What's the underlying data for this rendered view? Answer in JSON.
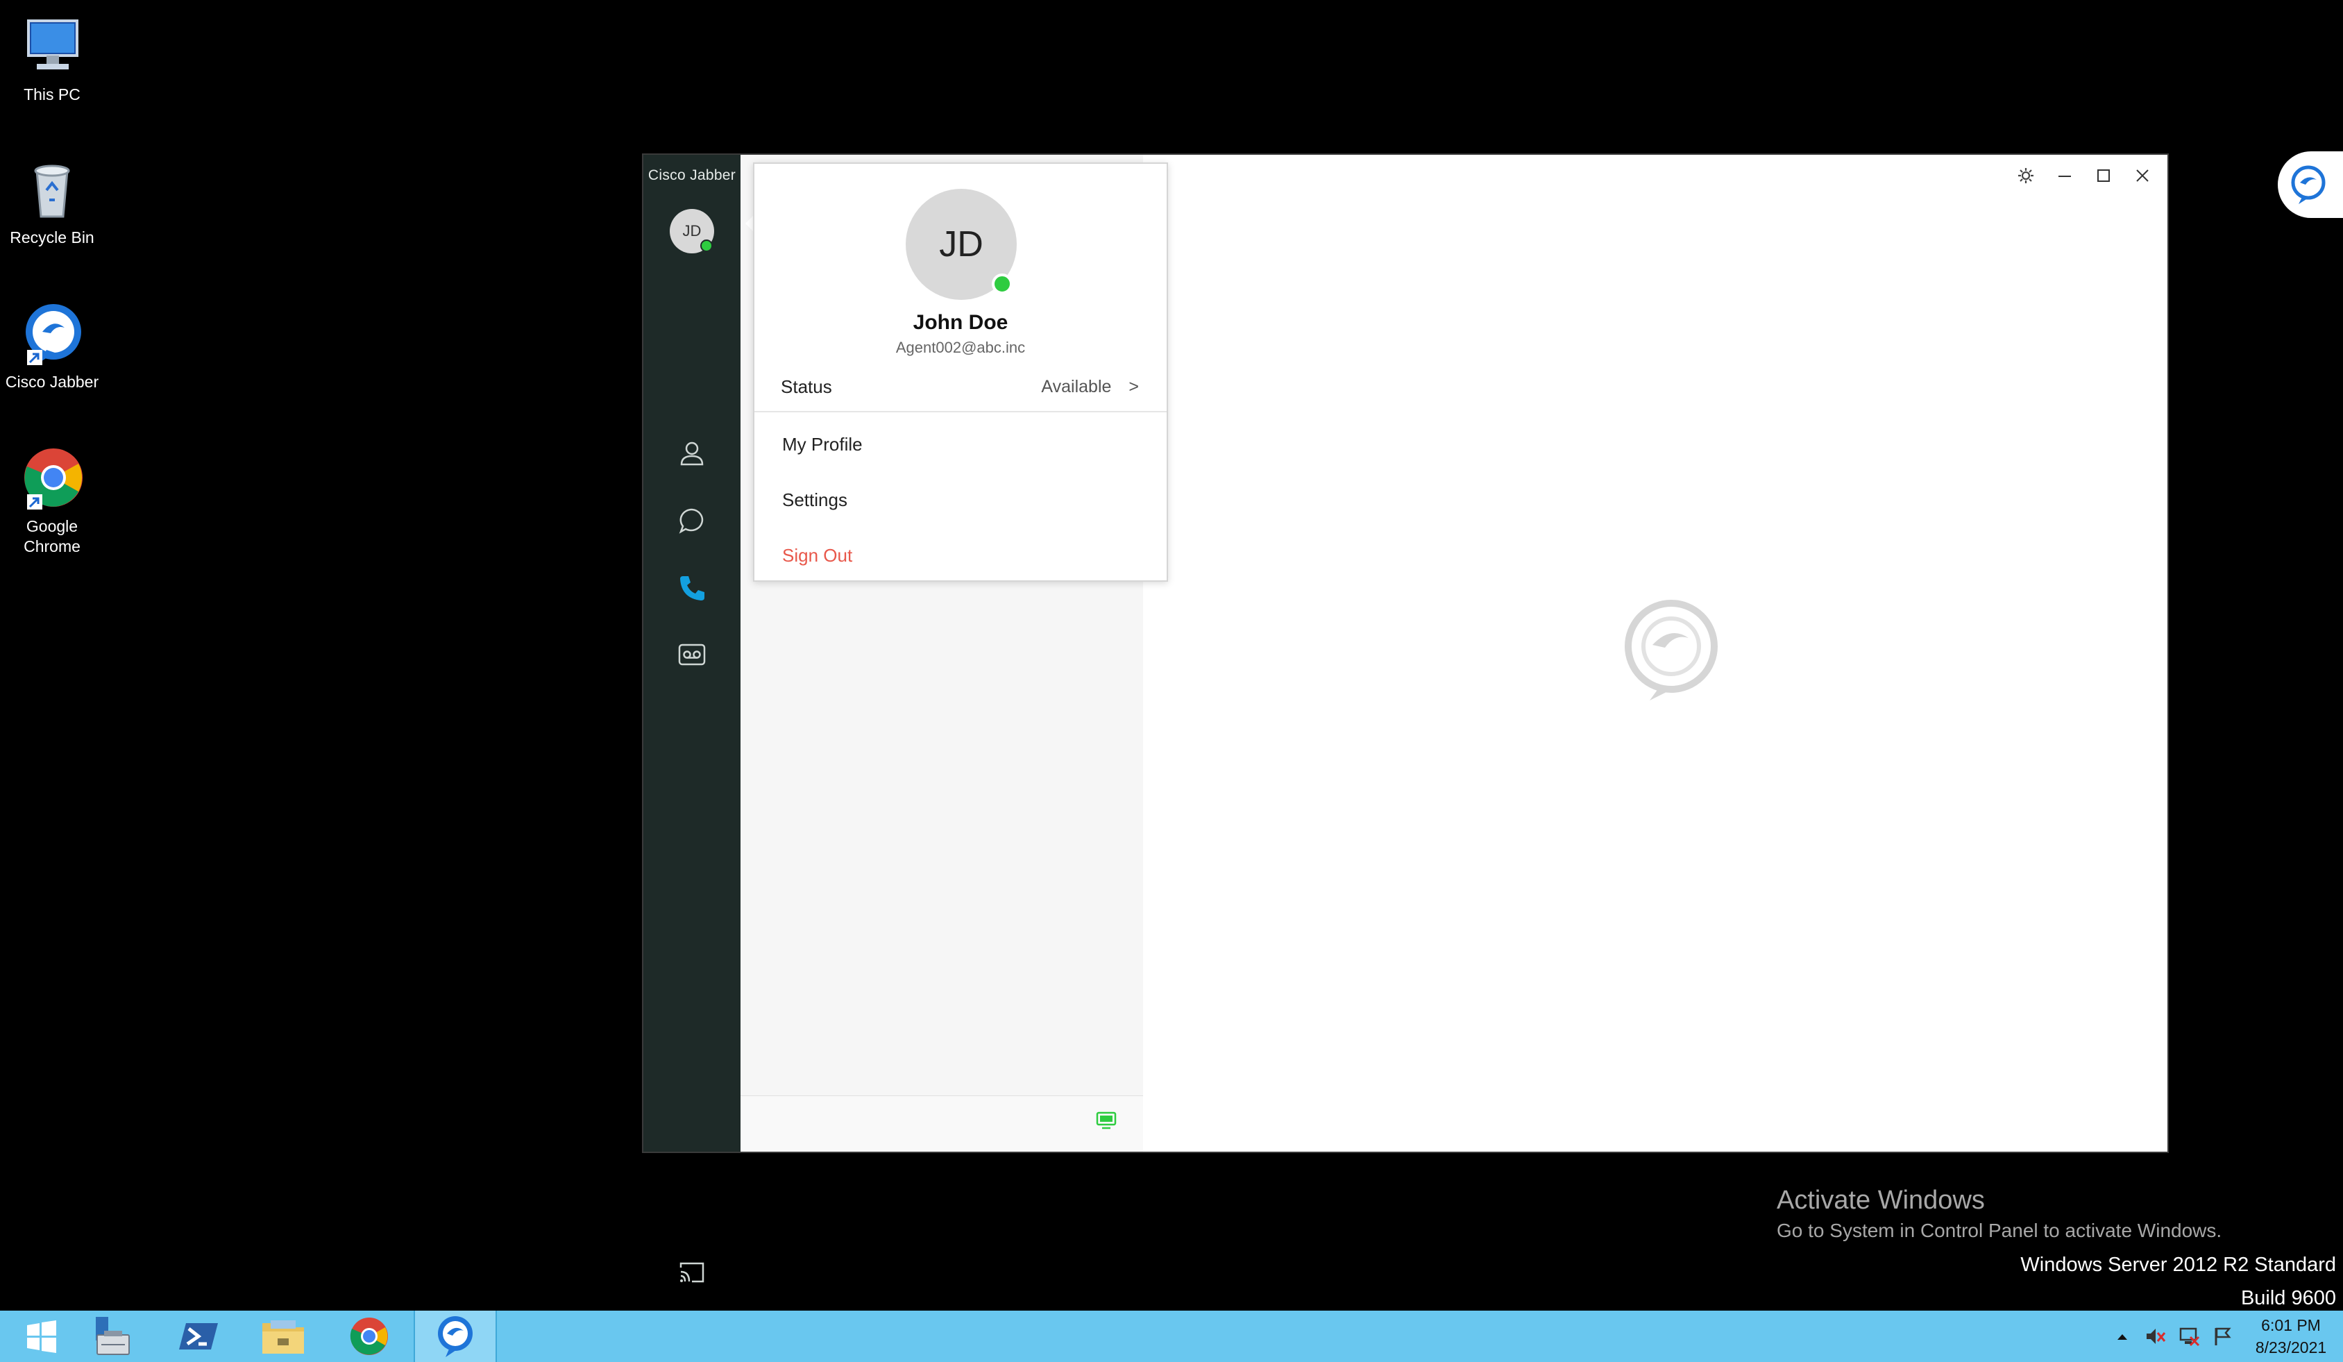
{
  "desktop": {
    "icons": [
      {
        "label": "This PC",
        "icon": "this-pc-icon"
      },
      {
        "label": "Recycle Bin",
        "icon": "recycle-bin-icon"
      },
      {
        "label": "Cisco Jabber",
        "icon": "cisco-jabber-icon"
      },
      {
        "label": "Google Chrome",
        "icon": "chrome-icon"
      }
    ]
  },
  "jabber": {
    "app_title": "Cisco Jabber",
    "user_initials": "JD",
    "nav": [
      "contacts-icon",
      "chats-icon",
      "calls-icon",
      "voicemail-icon",
      "cast-icon"
    ],
    "colors": {
      "rail": "#1e2a28",
      "active_nav": "#13a0e0",
      "presence_available": "#2ecc40",
      "sign_out": "#e8584b"
    }
  },
  "profile_menu": {
    "initials": "JD",
    "name": "John Doe",
    "email": "Agent002@abc.inc",
    "status_label": "Status",
    "status_value": "Available",
    "status_chevron": ">",
    "my_profile": "My Profile",
    "settings": "Settings",
    "sign_out": "Sign Out"
  },
  "activation": {
    "title": "Activate Windows",
    "subtitle": "Go to System in Control Panel to activate Windows.",
    "edition": "Windows Server 2012 R2 Standard",
    "build": "Build 9600"
  },
  "taskbar": {
    "apps": [
      "start-icon",
      "server-manager-icon",
      "powershell-icon",
      "file-explorer-icon",
      "chrome-icon",
      "cisco-jabber-icon"
    ],
    "time": "6:01 PM",
    "date": "8/23/2021"
  }
}
